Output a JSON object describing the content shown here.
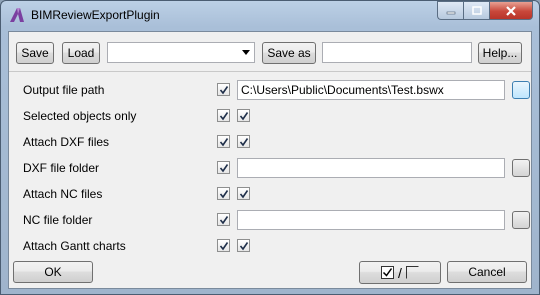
{
  "window": {
    "title": "BIMReviewExportPlugin"
  },
  "toolbar": {
    "save_label": "Save",
    "load_label": "Load",
    "preset_value": "",
    "save_as_label": "Save as",
    "save_as_value": "",
    "help_label": "Help..."
  },
  "rows": [
    {
      "label": "Output file path",
      "checkboxes": [
        true
      ],
      "value": "C:\\Users\\Public\\Documents\\Test.bswx",
      "browse": true
    },
    {
      "label": "Selected objects only",
      "checkboxes": [
        true,
        true
      ]
    },
    {
      "label": "Attach DXF files",
      "checkboxes": [
        true,
        true
      ]
    },
    {
      "label": "DXF file folder",
      "checkboxes": [
        true
      ],
      "value": "",
      "browse": true
    },
    {
      "label": "Attach NC files",
      "checkboxes": [
        true,
        true
      ]
    },
    {
      "label": "NC file folder",
      "checkboxes": [
        true
      ],
      "value": "",
      "browse": true
    },
    {
      "label": "Attach Gantt charts",
      "checkboxes": [
        true,
        true
      ]
    }
  ],
  "footer": {
    "ok_label": "OK",
    "toggle_separator": "/",
    "cancel_label": "Cancel"
  },
  "icons": {
    "app": "autodesk-a-icon",
    "minimize": "minimize-icon",
    "maximize": "maximize-icon",
    "close": "close-icon",
    "dropdown": "chevron-down-icon",
    "check": "check-icon"
  },
  "colors": {
    "title_gradient_top": "#bcd0e6",
    "close_button": "#c8473a",
    "app_icon": "#7b3fa0"
  }
}
